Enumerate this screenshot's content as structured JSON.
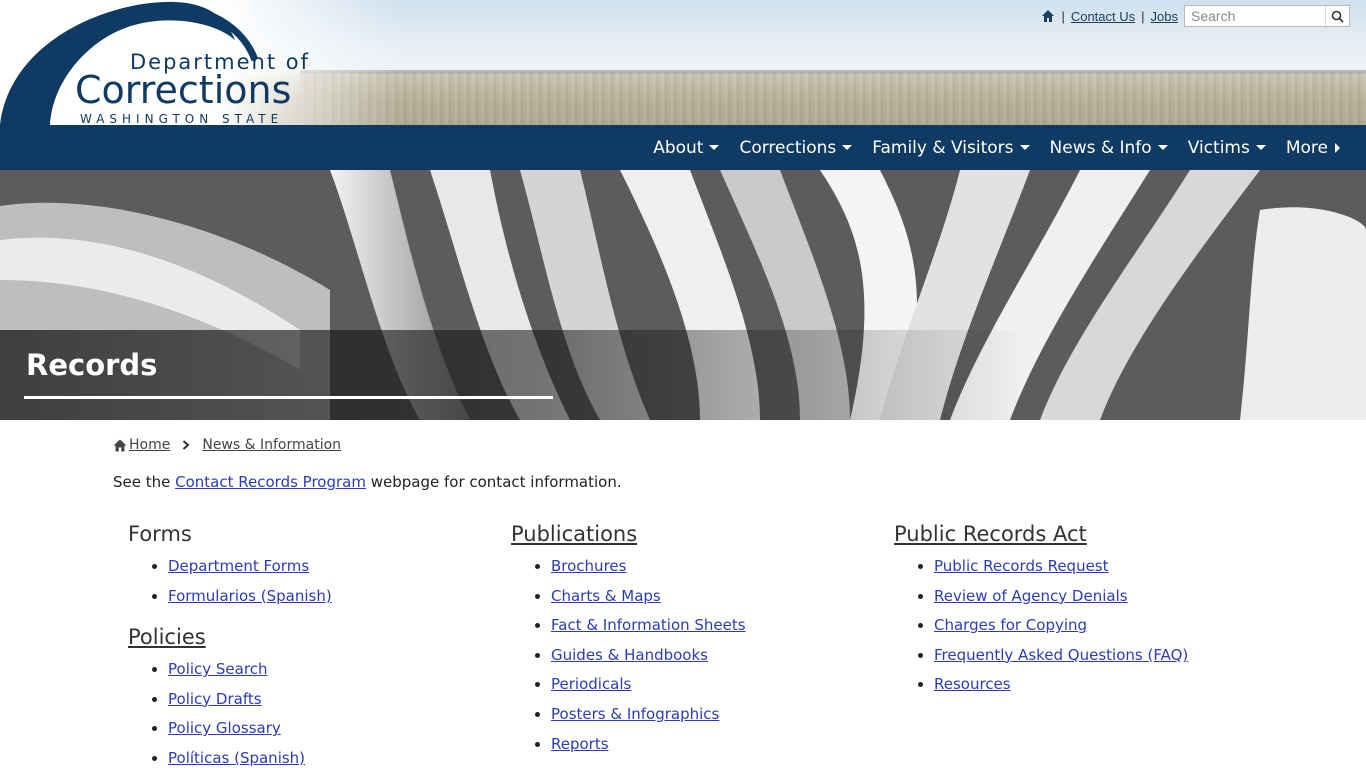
{
  "utility": {
    "contact_us": "Contact Us",
    "jobs": "Jobs",
    "separator": "|",
    "search_placeholder": "Search"
  },
  "logo": {
    "line1": "Department of",
    "line2": "Corrections",
    "line3": "WASHINGTON STATE"
  },
  "nav": {
    "items": [
      {
        "label": "About"
      },
      {
        "label": "Corrections"
      },
      {
        "label": "Family & Visitors"
      },
      {
        "label": "News & Info"
      },
      {
        "label": "Victims"
      },
      {
        "label": "More"
      }
    ]
  },
  "hero": {
    "title": "Records"
  },
  "breadcrumb": {
    "home": "Home",
    "current": "News & Information"
  },
  "intro": {
    "before": "See the ",
    "link": "Contact Records Program",
    "after": " webpage for contact information."
  },
  "columns": [
    {
      "sections": [
        {
          "heading": "Forms",
          "items": [
            "Department Forms",
            "Formularios (Spanish)"
          ]
        },
        {
          "heading": "Policies",
          "items": [
            "Policy Search",
            "Policy Drafts",
            "Policy Glossary",
            "Políticas (Spanish)"
          ]
        }
      ]
    },
    {
      "sections": [
        {
          "heading": "Publications",
          "items": [
            "Brochures",
            "Charts & Maps",
            "Fact & Information Sheets",
            "Guides & Handbooks",
            "Periodicals",
            "Posters & Infographics",
            "Reports"
          ]
        }
      ]
    },
    {
      "sections": [
        {
          "heading": "Public Records Act",
          "items": [
            "Public Records Request",
            "Review of Agency Denials",
            "Charges for Copying",
            "Frequently Asked Questions (FAQ)",
            "Resources"
          ]
        }
      ]
    }
  ],
  "colors": {
    "brand_navy": "#0e3a63",
    "link_blue": "#2b3bbd"
  }
}
